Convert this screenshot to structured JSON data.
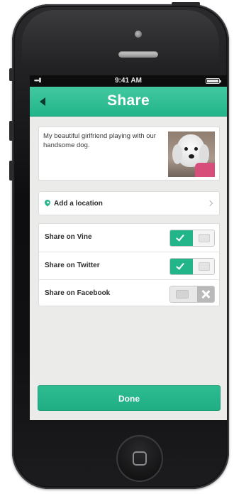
{
  "status_bar": {
    "signal": "•••ll",
    "time": "9:41 AM"
  },
  "nav": {
    "title": "Share"
  },
  "post": {
    "caption": "My beautiful girlfriend playing with our handsome dog."
  },
  "location": {
    "label": "Add a location"
  },
  "share_options": [
    {
      "label": "Share on Vine",
      "enabled": true
    },
    {
      "label": "Share on Twitter",
      "enabled": true
    },
    {
      "label": "Share on Facebook",
      "enabled": false
    }
  ],
  "done_button": {
    "label": "Done"
  },
  "colors": {
    "accent": "#22b58a",
    "background": "#ebebea",
    "phone_body": "#111113"
  },
  "icons": {
    "back": "chevron-left-icon",
    "location": "map-pin-icon",
    "disclosure": "chevron-right-icon",
    "toggle_on": "check-icon",
    "toggle_off": "x-icon"
  }
}
